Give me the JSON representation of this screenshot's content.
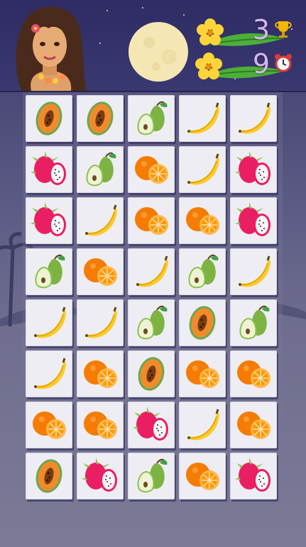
{
  "hud": {
    "score": "3",
    "score_icon": "trophy-icon",
    "timer": "9",
    "timer_icon": "alarm-clock-icon"
  },
  "character": "hula-girl-avatar",
  "decor": {
    "moon": "full-moon",
    "leaves": "palm-leaf-with-hibiscus"
  },
  "board": {
    "columns": 5,
    "rows": 8,
    "tiles": [
      [
        "papaya",
        "papaya",
        "pear",
        "banana",
        "banana"
      ],
      [
        "dragonfruit",
        "pear",
        "orange",
        "banana",
        "dragonfruit"
      ],
      [
        "dragonfruit",
        "banana",
        "orange",
        "orange",
        "dragonfruit"
      ],
      [
        "pear",
        "orange",
        "banana",
        "pear",
        "banana"
      ],
      [
        "banana",
        "banana",
        "pear",
        "papaya",
        "pear"
      ],
      [
        "banana",
        "orange",
        "papaya",
        "orange",
        "orange"
      ],
      [
        "orange",
        "orange",
        "dragonfruit",
        "banana",
        "orange"
      ],
      [
        "papaya",
        "dragonfruit",
        "pear",
        "orange",
        "dragonfruit"
      ]
    ]
  },
  "colors": {
    "sky_top": "#2e2c63",
    "hud_text": "#d9b3f0",
    "tile_bg": "#eeedf3"
  }
}
